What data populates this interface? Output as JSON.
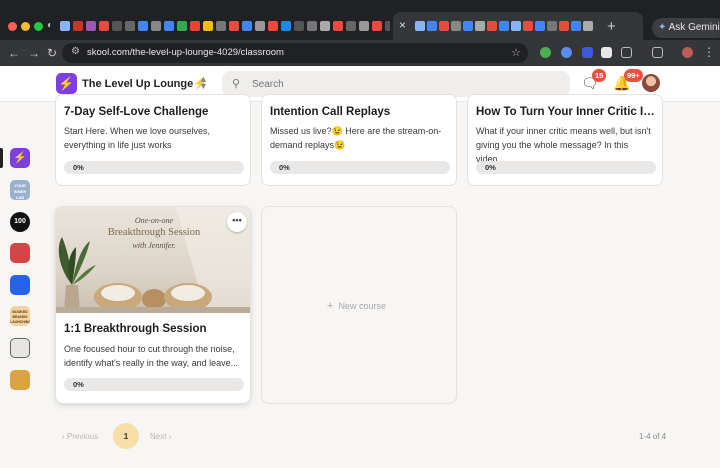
{
  "browser": {
    "active_tab_close": "×",
    "new_tab": "+",
    "gemini_label": "Ask Gemini",
    "url": "skool.com/the-level-up-lounge-4029/classroom"
  },
  "header": {
    "group_name": "The Level Up Lounge⚡",
    "search_placeholder": "Search",
    "chat_badge": "15",
    "notification_badge": "99+"
  },
  "rail": [
    "⚡",
    "YOUR INNER LAB",
    "100",
    "",
    "",
    "BOOKED BRANDS LAUNCHING",
    "",
    ""
  ],
  "courses": [
    {
      "title": "7-Day Self-Love Challenge",
      "description": "Start Here. When we love ourselves, everything in life just works",
      "progress": "0%"
    },
    {
      "title": "Intention Call Replays",
      "description": "Missed us live?😉 Here are the stream-on-demand replays😉",
      "progress": "0%"
    },
    {
      "title": "How To Turn Your Inner Critic Into...",
      "description": "What if your inner critic means well, but isn't giving you the whole message? In this video...",
      "progress": "0%"
    },
    {
      "title": "1:1 Breakthrough Session",
      "description": "One focused hour to cut through the noise, identify what's really in the way, and leave...",
      "progress": "0%",
      "cover": {
        "line1": "One-on-one",
        "line2": "Breakthrough Session",
        "line3": "with Jennifer."
      },
      "menu": "•••"
    }
  ],
  "new_course_label": "New course",
  "pagination": {
    "previous": "Previous",
    "current": "1",
    "next": "Next",
    "range": "1-4 of 4"
  }
}
